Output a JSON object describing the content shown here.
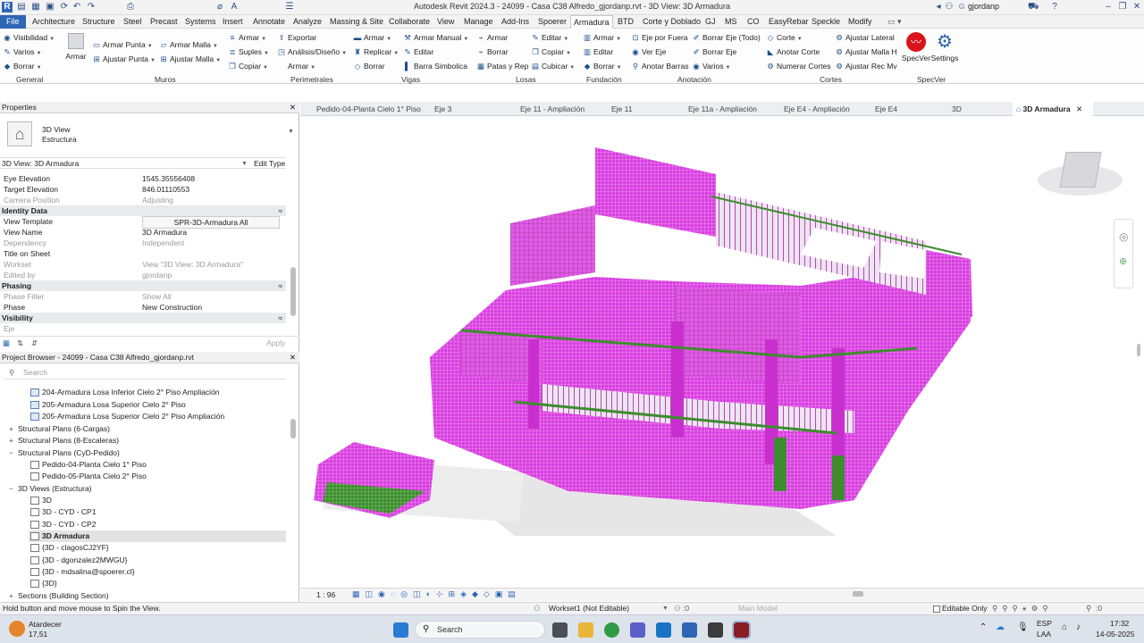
{
  "titlebar": {
    "title": "Autodesk Revit 2024.3 - 24099 - Casa C38 Alfredo_gjordanp.rvt - 3D View: 3D Armadura",
    "user": "gjordanp"
  },
  "menu": [
    "File",
    "Architecture",
    "Structure",
    "Steel",
    "Precast",
    "Systems",
    "Insert",
    "Annotate",
    "Analyze",
    "Massing & Site",
    "Collaborate",
    "View",
    "Manage",
    "Add-Ins",
    "Spoerer",
    "Armadura",
    "BTD",
    "Corte y Doblado",
    "GJ",
    "MS",
    "CO",
    "EasyRebar",
    "Speckle",
    "Modify"
  ],
  "ribbon": {
    "general": [
      "Visibilidad",
      "Varios",
      "Borrar"
    ],
    "armar": "Armar",
    "muros": [
      "Armar Punta",
      "Ajustar Punta",
      "Armar Malla",
      "Ajustar Malla"
    ],
    "perimetrales": [
      "Armar",
      "Suples",
      "Copiar",
      "Exportar",
      "Análisis/Diseño",
      "Armar"
    ],
    "vigas": [
      "Armar",
      "Replicar",
      "Borrar",
      "Armar Manual",
      "Editar",
      "Barra Simbolica"
    ],
    "losas": [
      "Armar",
      "Borrar",
      "Patas y Rep"
    ],
    "losas2": [
      "Editar",
      "Copiar",
      "Cubicar"
    ],
    "fundacion": [
      "Armar",
      "Editar",
      "Borrar"
    ],
    "anotacion": [
      "Eje por Fuera",
      "Ver Eje",
      "Anotar Barras",
      "Borrar Eje (Todo)",
      "Borrar Eje",
      "Varios"
    ],
    "cortes": [
      "Corte",
      "Anotar Corte",
      "Numerar Cortes",
      "Ajustar Lateral",
      "Ajustar Malla H",
      "Ajustar Rec Mv"
    ],
    "specver": [
      "SpecVer",
      "Settings"
    ],
    "groups": [
      "General",
      "Muros",
      "Perimetrales",
      "Vigas",
      "Losas",
      "Fundación",
      "Anotación",
      "Cortes",
      "SpecVer"
    ]
  },
  "properties": {
    "title": "Properties",
    "type_name": "3D View",
    "type_sub": "Estructura",
    "selector": "3D View: 3D Armadura",
    "edit_type": "Edit Type",
    "rows1": [
      [
        "Eye Elevation",
        "1545.35556408"
      ],
      [
        "Target Elevation",
        "846.01110553"
      ],
      [
        "Camera Position",
        "Adjusting"
      ]
    ],
    "identity": "Identity Data",
    "rows2": [
      [
        "View Template",
        "SPR-3D-Armadura All"
      ],
      [
        "View Name",
        "3D Armadura"
      ],
      [
        "Dependency",
        "Independent"
      ],
      [
        "Title on Sheet",
        ""
      ],
      [
        "Workset",
        "View \"3D View: 3D Armadura\""
      ],
      [
        "Edited by",
        "gjordanp"
      ]
    ],
    "phasing": "Phasing",
    "rows3": [
      [
        "Phase Filter",
        "Show All"
      ],
      [
        "Phase",
        "New Construction"
      ]
    ],
    "visibility": "Visibility",
    "eje": "Eje",
    "apply": "Apply"
  },
  "browser": {
    "title": "Project Browser - 24099 - Casa C38 Alfredo_gjordanp.rvt",
    "search": "Search",
    "items": [
      "204-Armadura Losa Inferior Cielo 2° Piso Ampliación",
      "205-Armadura Losa Superior Cielo 2° Piso",
      "205-Armadura Losa Superior Cielo 2° Piso Ampliación",
      "Structural Plans (6-Cargas)",
      "Structural Plans (8-Escaleras)",
      "Structural Plans (CyD-Pedido)",
      "Pedido-04-Planta Cielo 1° Piso",
      "Pedido-05-Planta Cielo 2° Piso",
      "3D Views (Estructura)",
      "3D",
      "3D - CYD - CP1",
      "3D - CYD - CP2",
      "3D Armadura",
      "{3D - clagosCJ2YF}",
      "{3D - dgonzalez2MWGU}",
      "{3D - mdsalina@spoerer.cl}",
      "{3D}",
      "Sections (Building Section)"
    ]
  },
  "tabs": [
    "Pedido-04-Planta Cielo 1° Piso",
    "Eje 3",
    "Eje 11 - Ampliación",
    "Eje 11",
    "Eje 11a - Ampliación",
    "Eje E4 - Ampliación",
    "Eje E4",
    "3D",
    "3D Armadura"
  ],
  "viewbar": {
    "scale": "1 : 96"
  },
  "status": {
    "hint": "Hold button and move mouse to Spin the View.",
    "workset": "Workset1 (Not Editable)",
    "mainmodel": "Main Model",
    "editable": "Editable Only",
    "filter": ":0"
  },
  "taskbar": {
    "weather": "Atardecer",
    "temp": "17,51",
    "search": "Search",
    "lang": "ESP",
    "lang2": "LAA",
    "time": "17:32",
    "date": "14-05-2025"
  }
}
